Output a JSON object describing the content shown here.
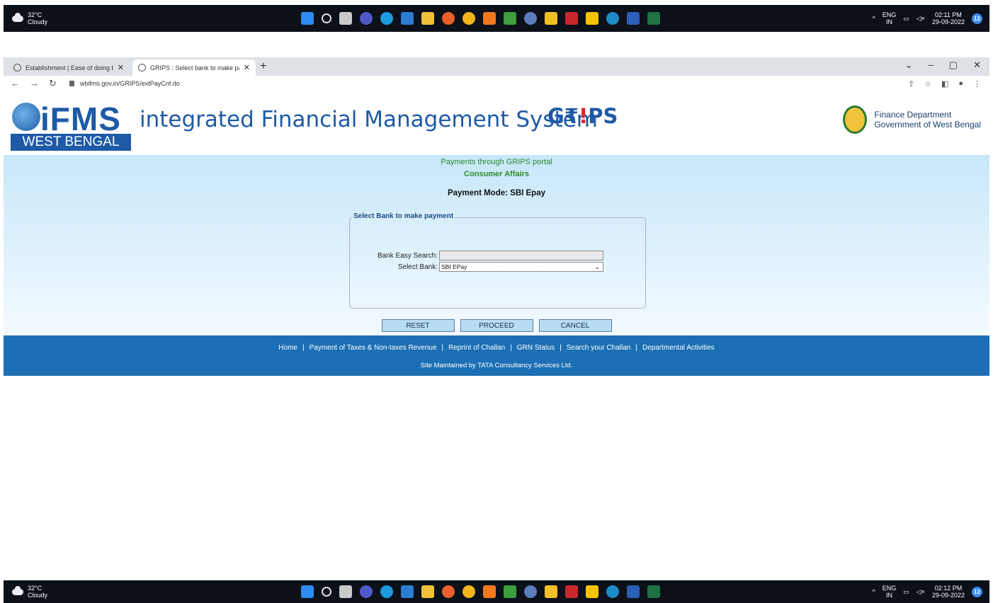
{
  "taskbar_top": {
    "weather_temp": "32°C",
    "weather_desc": "Cloudy",
    "lang": "ENG",
    "region": "IN",
    "time": "02:11 PM",
    "date": "29-09-2022",
    "notifications": "12"
  },
  "taskbar_bottom": {
    "weather_temp": "32°C",
    "weather_desc": "Cloudy",
    "lang": "ENG",
    "region": "IN",
    "time": "02:12 PM",
    "date": "29-09-2022",
    "notifications": "12"
  },
  "browser": {
    "tabs": [
      {
        "label": "Establishment | Ease of doing bu"
      },
      {
        "label": "GRIPS : Select bank to make pay"
      }
    ],
    "url": "wbifms.gov.in/GRIPS/extPayCnf.do"
  },
  "header": {
    "logo_text": "iFMS",
    "logo_sub": "WEST BENGAL",
    "title": "integrated Financial Management System",
    "grips_pre": "G₹",
    "grips_bang": "!",
    "grips_post": "PS",
    "dept_line1": "Finance Department",
    "dept_line2": "Government of West Bengal"
  },
  "main": {
    "portal_title": "Payments through GRIPS portal",
    "department": "Consumer Affairs",
    "payment_mode": "Payment Mode: SBI Epay",
    "fieldset_legend": "Select Bank to make payment",
    "bank_search_label": "Bank Easy Search:",
    "bank_search_value": "",
    "select_bank_label": "Select Bank:",
    "select_bank_value": "SBI EPay",
    "buttons": {
      "reset": "RESET",
      "proceed": "PROCEED",
      "cancel": "CANCEL"
    }
  },
  "footer": {
    "links": [
      "Home",
      "Payment of Taxes & Non-taxes Revenue",
      "Reprint of Challan",
      "GRN Status",
      "Search your Challan",
      "Departmental Activities"
    ],
    "separator": "|",
    "maintained": "Site Maintained by TATA Consultancy Services Ltd."
  },
  "colors": {
    "brand_blue": "#1e5aa6",
    "footer_blue": "#1c6fb4",
    "green_text": "#2c8a2c",
    "grips_red": "#e8232a"
  },
  "icons": [
    "cloud-icon",
    "windows-icon",
    "search-icon",
    "chrome-icon",
    "back-icon",
    "forward-icon",
    "reload-icon",
    "lock-icon",
    "share-icon",
    "star-icon",
    "sidebar-icon",
    "profile-icon",
    "menu-icon",
    "emblem-icon"
  ]
}
